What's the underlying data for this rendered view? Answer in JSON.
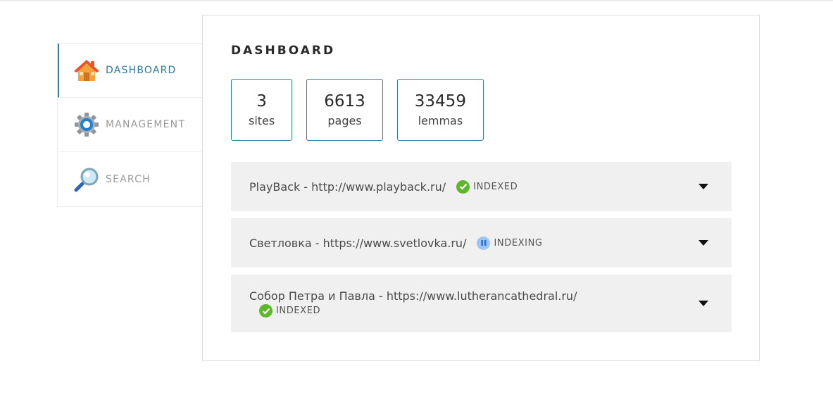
{
  "sidebar": {
    "items": [
      {
        "label": "DASHBOARD",
        "icon": "home-icon",
        "active": true
      },
      {
        "label": "MANAGEMENT",
        "icon": "gear-icon",
        "active": false
      },
      {
        "label": "SEARCH",
        "icon": "magnifier-icon",
        "active": false
      }
    ]
  },
  "main": {
    "title": "DASHBOARD",
    "stats": [
      {
        "value": "3",
        "label": "sites"
      },
      {
        "value": "6613",
        "label": "pages"
      },
      {
        "value": "33459",
        "label": "lemmas"
      }
    ],
    "sites": [
      {
        "title": "PlayBack - http://www.playback.ru/",
        "status": "INDEXED",
        "status_icon": "check-icon"
      },
      {
        "title": "Светловка - https://www.svetlovka.ru/",
        "status": "INDEXING",
        "status_icon": "pause-icon"
      },
      {
        "title": "Собор Петра и Павла - https://www.lutherancathedral.ru/",
        "status": "INDEXED",
        "status_icon": "check-icon"
      }
    ]
  },
  "colors": {
    "accent": "#2b7fa6",
    "indexed": "#5cb82a",
    "indexing": "#6aa8e8",
    "row_bg": "#f0f0f0"
  }
}
